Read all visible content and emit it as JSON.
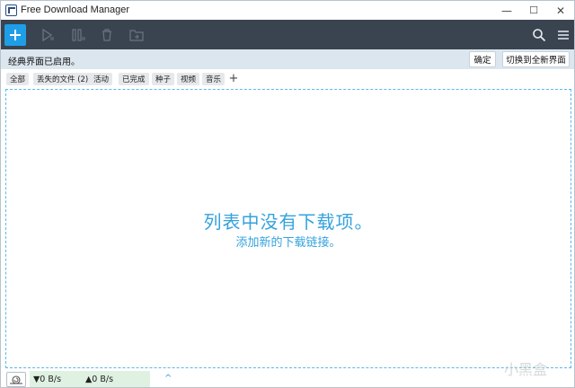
{
  "window": {
    "title": "Free Download Manager",
    "controls": {
      "minimize": "—",
      "maximize": "☐",
      "close": "✕"
    }
  },
  "toolbar": {
    "icons": [
      "add-download-icon",
      "resume-icon",
      "pause-icon",
      "delete-icon",
      "folder-icon",
      "search-icon",
      "menu-icon"
    ]
  },
  "notice": {
    "text": "经典界面已启用。",
    "confirm_label": "确定",
    "switch_label": "切换到全新界面"
  },
  "tags": [
    {
      "label": "全部"
    },
    {
      "label": "丢失的文件 (2)"
    },
    {
      "label": "活动"
    },
    {
      "label": "已完成"
    },
    {
      "label": "种子"
    },
    {
      "label": "视频"
    },
    {
      "label": "音乐"
    }
  ],
  "tag_add_label": "+",
  "empty_state": {
    "title": "列表中没有下载项。",
    "subtitle": "添加新的下载链接。"
  },
  "status": {
    "download_speed": "▼0 B/s",
    "upload_speed": "▲0 B/s",
    "expand_glyph": "^"
  },
  "watermark": "小黑盒",
  "colors": {
    "toolbar_bg": "#3a4350",
    "accent": "#1f9ee8",
    "notice_bg": "#dce6ef",
    "empty_text": "#35a2dd",
    "speed_bg": "#dff1e0"
  }
}
